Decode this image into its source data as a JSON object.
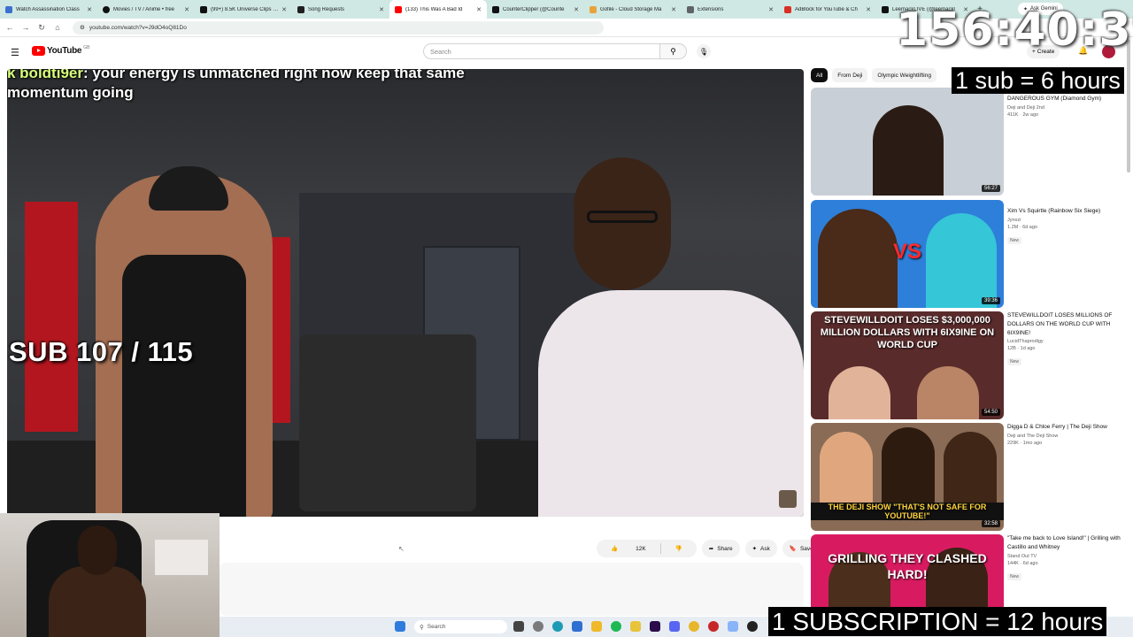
{
  "browser": {
    "tabs": [
      {
        "title": "Watch Assassination Class",
        "color": "#3d6fd1"
      },
      {
        "title": "Movies / TV / Anime • free",
        "color": "#111111"
      },
      {
        "title": "(99+) 8.5K Universe Clips (@",
        "color": "#111111"
      },
      {
        "title": "Song Requests",
        "color": "#1f1f1f"
      },
      {
        "title": "(133) This Was A Bad Id",
        "color": "#ff0000",
        "active": true
      },
      {
        "title": "CounterClipper (@Counte",
        "color": "#111111"
      },
      {
        "title": "Gofile - Cloud Storage Ma",
        "color": "#e8a33a"
      },
      {
        "title": "Extensions",
        "color": "#5f6368"
      },
      {
        "title": "AdBlock for YouTube & Ch",
        "color": "#d93025"
      },
      {
        "title": "LeemackLIVE (@leemackl",
        "color": "#111111"
      }
    ],
    "gemini_label": "Ask Gemini",
    "url": "youtube.com/watch?v=J9dO4oQ81Do"
  },
  "youtube": {
    "logo_text": "YouTube",
    "country": "GB",
    "search_placeholder": "Search",
    "create_label": "Create",
    "chips": [
      "All",
      "From Deji",
      "Olympic Weightlifting"
    ],
    "actions": {
      "likes": "12K",
      "share": "Share",
      "ask": "Ask",
      "save": "Save"
    },
    "recommendations": [
      {
        "title": "DANGEROUS GYM (Diamond Gym)",
        "channel": "Deji and Deji 2nd",
        "stats": "411K · 2w ago",
        "duration": "56:27",
        "new": "",
        "thumb_text": "",
        "bg": "#c9cfd6"
      },
      {
        "title": "Xim Vs Squirtle (Rainbow Six Siege)",
        "channel": "Jynxzi",
        "stats": "1.2M · 6d ago",
        "duration": "39:36",
        "new": "New",
        "thumb_text": "VS",
        "bg": "#2e7fd9"
      },
      {
        "title": "STEVEWILLDOIT LOSES MILLIONS OF DOLLARS ON THE WORLD CUP WITH 6IX9INE!",
        "channel": "LucidThaprodigy",
        "stats": "12B · 1d ago",
        "duration": "54:50",
        "new": "New",
        "thumb_text": "STEVEWILLDOIT LOSES $3,000,000 MILLION DOLLARS WITH 6IX9INE ON WORLD CUP",
        "bg": "#5a2b2b"
      },
      {
        "title": "Digga D & Chloe Ferry | The Deji Show",
        "channel": "Deji and The Deji Show",
        "stats": "229K · 1mo ago",
        "duration": "32:58",
        "new": "",
        "thumb_text": "THE DEJI SHOW \"THAT'S NOT SAFE FOR YOUTUBE!\"",
        "bg": "#8a6b56"
      },
      {
        "title": "\"Take me back to Love Island!\" | Grilling with Castillo and Whitney",
        "channel": "Stand Out TV",
        "stats": "144K · 6d ago",
        "duration": "",
        "new": "New",
        "thumb_text": "GRILLING THEY CLASHED HARD!",
        "bg": "#d81b60"
      }
    ]
  },
  "video_overlay": {
    "chat_user": "k boldti9er",
    "chat_message": "your energy is unmatched right now keep that same momentum going",
    "sub_count": "SUB 107 / 115"
  },
  "stream_overlay": {
    "timer": "156:40:39",
    "sub_rate": "1 sub = 6 hours",
    "subscription_rate": "1 SUBSCRIPTION = 12 hours"
  },
  "taskbar": {
    "search_placeholder": "Search"
  }
}
